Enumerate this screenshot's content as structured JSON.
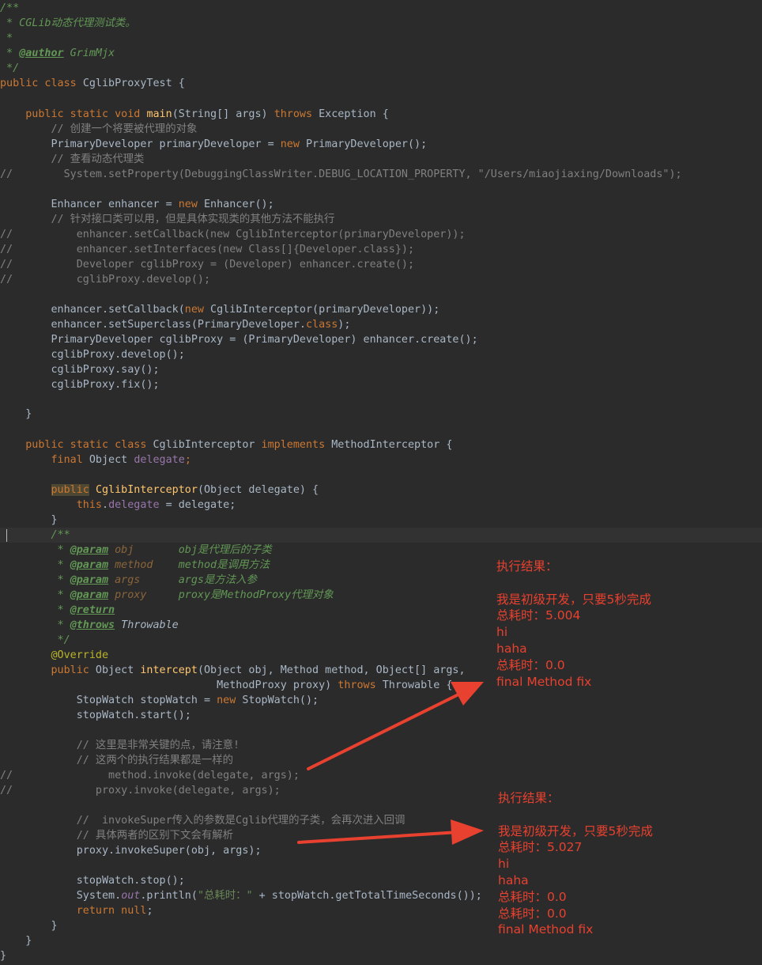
{
  "code": {
    "javadoc_open": "/**",
    "javadoc_desc": " * CGLib动态代理测试类。",
    "javadoc_blank": " *",
    "author_prefix": " * ",
    "author_tag": "@author",
    "author_name": " GrimMjx",
    "javadoc_close": " */",
    "class_kw": "public class ",
    "class_name": "CglibProxyTest {",
    "main_mods": "    public static void ",
    "main_name": "main",
    "main_sig": "(String[] args) ",
    "main_throws_kw": "throws",
    "main_tail": " Exception {",
    "c_create": "        // 创建一个将要被代理的对象",
    "pd_decl": "        PrimaryDeveloper primaryDeveloper = ",
    "new_kw": "new",
    "pd_new": " PrimaryDeveloper();",
    "c_view": "        // 查看动态代理类",
    "set_prop_slash": "//",
    "set_prop_code": "        System.setProperty(DebuggingClassWriter.DEBUG_LOCATION_PROPERTY, ",
    "set_prop_str": "\"/Users/miaojiaxing/Downloads\"",
    "set_prop_end": ");",
    "enh_decl": "        Enhancer enhancer = ",
    "enh_new": " Enhancer();",
    "c_iface": "        // 针对接口类可以用，但是具体实现类的其他方法不能执行",
    "cm1": "          enhancer.setCallback(new CglibInterceptor(primaryDeveloper));",
    "cm2": "          enhancer.setInterfaces(new Class[]{Developer.class});",
    "cm3": "          Developer cglibProxy = (Developer) enhancer.create();",
    "cm4": "          cglibProxy.develop();",
    "e1a": "        enhancer.setCallback(",
    "e1b": " CglibInterceptor(primaryDeveloper));",
    "e2a": "        enhancer.setSuperclass(PrimaryDeveloper.",
    "class_kw2": "class",
    "e2b": ");",
    "e3": "        PrimaryDeveloper cglibProxy = (PrimaryDeveloper) enhancer.create();",
    "e4": "        cglibProxy.develop();",
    "e5": "        cglibProxy.say();",
    "e6": "        cglibProxy.fix();",
    "close_main": "    }",
    "inner_mods": "    public static class ",
    "inner_name": "CglibInterceptor ",
    "implements_kw": "implements",
    "inner_tail": " MethodInterceptor {",
    "final_kw": "        final",
    "final_type": " Object ",
    "delegate_field": "delegate",
    "semi": ";",
    "ctor_indent": "        ",
    "ctor_public": "public",
    "ctor_name": "CglibInterceptor",
    "ctor_sig": "(Object delegate) {",
    "this_kw": "            this",
    "this_assign": ".",
    "this_rest": " = delegate;",
    "close_ctor": "        }",
    "jd2_open": "        /**",
    "p_obj_tag": "@param",
    "p_obj_name": "obj",
    "p_obj_desc": "obj是代理后的子类",
    "p_method_tag": "@param",
    "p_method_name": "method",
    "p_method_desc": "method是调用方法",
    "p_args_tag": "@param",
    "p_args_name": "args",
    "p_args_desc": "args是方法入参",
    "p_proxy_tag": "@param",
    "p_proxy_name": "proxy",
    "p_proxy_desc": "proxy是MethodProxy代理对象",
    "return_tag": "@return",
    "throws_tag": "@throws",
    "throws_name": " Throwable",
    "jd2_close": "         */",
    "override": "        @Override",
    "int_public": "        public",
    "int_type": " Object ",
    "int_name": "intercept",
    "int_sig": "(Object obj, Method method, Object[] args,",
    "int_cont": "                                  MethodProxy proxy) ",
    "int_throws": "throws",
    "int_tail": " Throwable {",
    "sw_decl": "            StopWatch stopWatch = ",
    "sw_new": " StopWatch();",
    "sw_start": "            stopWatch.start();",
    "c_key": "            // 这里是非常关键的点，请注意!",
    "c_same": "            // 这两个的执行结果都是一样的",
    "mi": "               method.invoke(delegate, args);",
    "pi": "             proxy.invoke(delegate, args);",
    "c_super": "            //  invokeSuper传入的参数是Cglib代理的子类，会再次进入回调",
    "c_diff": "            // 具体两者的区别下文会有解析",
    "pis": "            proxy.invokeSuper(obj, args);",
    "sw_stop": "            stopWatch.stop();",
    "pr_a": "            System.",
    "pr_out": "out",
    "pr_b": ".println(",
    "pr_str": "\"总耗时：\"",
    "pr_c": " + stopWatch.getTotalTimeSeconds());",
    "ret_kw": "            return",
    "ret_null": " null",
    "close_int": "        }",
    "close_inner": "    }",
    "close_class": "}"
  },
  "result1": {
    "title": "执行结果：",
    "lines": [
      "我是初级开发，只要5秒完成",
      "总耗时：5.004",
      "hi",
      "haha",
      "总耗时：0.0",
      "final Method fix"
    ]
  },
  "result2": {
    "title": "执行结果：",
    "lines": [
      "我是初级开发，只要5秒完成",
      "总耗时：5.027",
      "hi",
      "haha",
      "总耗时：0.0",
      "总耗时：0.0",
      "final Method fix"
    ]
  },
  "colors": {
    "background": "#2b2b2b",
    "annotation_red": "#e8412f"
  }
}
